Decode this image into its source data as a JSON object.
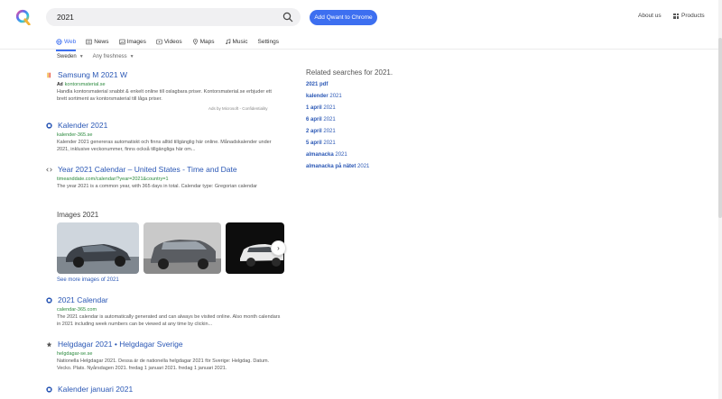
{
  "header": {
    "search_value": "2021",
    "cta_label": "Add Qwant to Chrome",
    "about_label": "About us",
    "products_label": "Products"
  },
  "tabs": [
    {
      "label": "Web",
      "icon": "globe-icon"
    },
    {
      "label": "News",
      "icon": "news-icon"
    },
    {
      "label": "Images",
      "icon": "image-icon"
    },
    {
      "label": "Videos",
      "icon": "video-icon"
    },
    {
      "label": "Maps",
      "icon": "map-pin-icon"
    },
    {
      "label": "Music",
      "icon": "music-icon"
    },
    {
      "label": "Settings",
      "icon": ""
    }
  ],
  "filters": {
    "region": "Sweden",
    "freshness": "Any freshness"
  },
  "results": [
    {
      "title": "Samsung M 2021 W",
      "ad_badge": "Ad",
      "url": "kontorsmaterial.se",
      "desc": "Handla kontorsmaterial snabbt & enkelt online till oslagbara priser. Kontorsmaterial.se erbjuder ett brett sortiment av kontorsmaterial till låga priser.",
      "ad_footer": "Ads by Microsoft - Confidentiality"
    },
    {
      "title": "Kalender 2021",
      "url": "kalender-365.se",
      "desc": "Kalender 2021 genereras automatiskt och finns alltid tillgänglig här online. Månadskalender under 2021, inklusive veckonummer, finns också tillgängliga här om..."
    },
    {
      "title": "Year 2021 Calendar – United States - Time and Date",
      "url": "timeanddate.com/calendar/?year=2021&country=1",
      "desc": "The year 2021 is a common year, with 365 days in total. Calendar type: Gregorian calendar"
    },
    {
      "title": "2021 Calendar",
      "url": "calendar-365.com",
      "desc": "The 2021 calendar is automatically generated and can always be visited online. Also month calendars in 2021 including week numbers can be viewed at any time by clickin..."
    },
    {
      "title": "Helgdagar 2021 • Helgdagar Sverige",
      "url": "helgdagar-se.se",
      "desc": "Nationella Helgdagar 2021. Dessa är de nationella helgdagar 2021 för Sverige: Helgdag. Datum. Vecko. Plats. Nyårsdagen 2021. fredag 1 januari 2021. fredag 1 januari 2021."
    },
    {
      "title": "Kalender januari 2021"
    }
  ],
  "images_section": {
    "title": "Images 2021",
    "see_more": "See more images of 2021",
    "next_icon": "›"
  },
  "related": {
    "title": "Related searches for 2021.",
    "items": [
      {
        "bold": "2021 pdf",
        "rest": ""
      },
      {
        "bold": "kalender",
        "rest": " 2021"
      },
      {
        "bold": "1 april",
        "rest": " 2021"
      },
      {
        "bold": "6 april",
        "rest": " 2021"
      },
      {
        "bold": "2 april",
        "rest": " 2021"
      },
      {
        "bold": "5 april",
        "rest": " 2021"
      },
      {
        "bold": "almanacka",
        "rest": " 2021"
      },
      {
        "bold": "almanacka på nätet",
        "rest": " 2021"
      }
    ]
  },
  "colors": {
    "accent": "#3d6ff0",
    "link": "#2a57b5",
    "url_green": "#2b8a3e"
  }
}
